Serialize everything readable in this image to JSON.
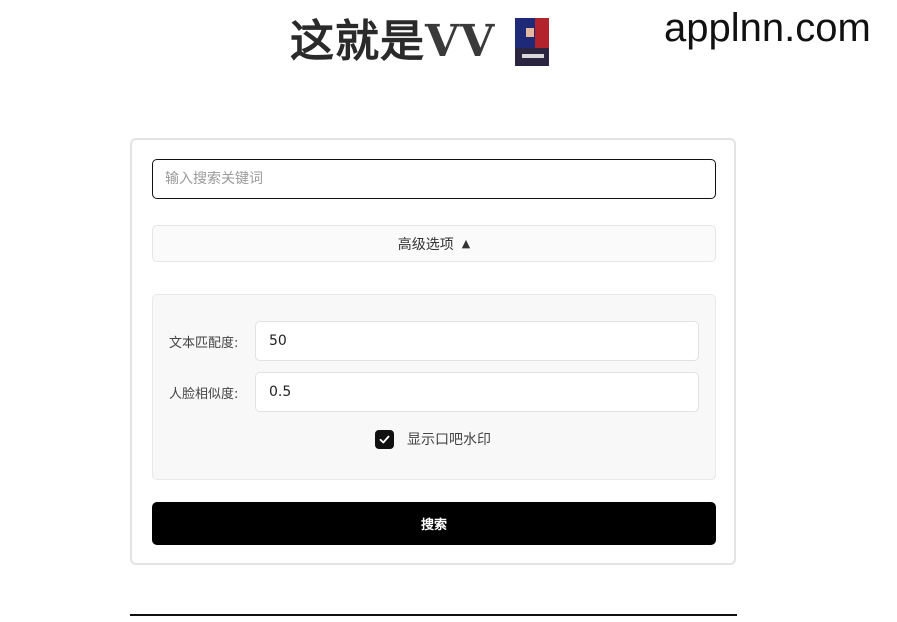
{
  "header": {
    "title_cn": "这就是",
    "title_vv": "VV",
    "logo_icon": "vv-avatar-icon"
  },
  "watermark": "applnn.com",
  "search": {
    "placeholder": "输入搜索关键词",
    "value": ""
  },
  "advanced": {
    "toggle_label": "高级选项",
    "toggle_arrow": "▲",
    "expanded": true,
    "text_match": {
      "label": "文本匹配度:",
      "value": "50"
    },
    "face_similarity": {
      "label": "人脸相似度:",
      "value": "0.5"
    },
    "show_watermark": {
      "label": "显示口吧水印",
      "checked": true
    }
  },
  "search_button": {
    "label": "搜索"
  },
  "colors": {
    "primary_button": "#000000",
    "panel_bg": "#f8f8f8",
    "border": "#e3e3e3"
  }
}
